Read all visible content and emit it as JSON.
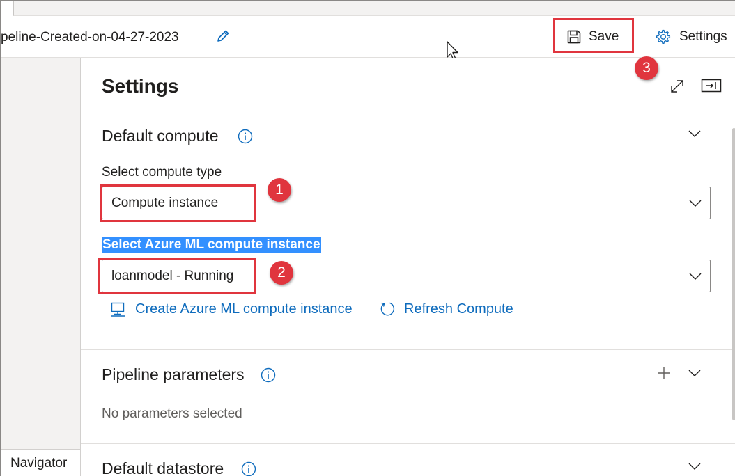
{
  "header": {
    "pipeline_name": "peline-Created-on-04-27-2023",
    "save_label": "Save",
    "settings_label": "Settings"
  },
  "callouts": {
    "badge_1": "1",
    "badge_2": "2",
    "badge_3": "3"
  },
  "left": {
    "navigator_label": "Navigator"
  },
  "panel": {
    "title": "Settings",
    "default_compute": {
      "title": "Default compute",
      "compute_type_label": "Select compute type",
      "compute_type_value": "Compute instance",
      "instance_label": "Select Azure ML compute instance",
      "instance_value": "loanmodel - Running",
      "create_link": "Create Azure ML compute instance",
      "refresh_link": "Refresh Compute"
    },
    "pipeline_parameters": {
      "title": "Pipeline parameters",
      "empty_text": "No parameters selected"
    },
    "default_datastore": {
      "title": "Default datastore"
    }
  },
  "colors": {
    "accent_link": "#0f6cbd",
    "callout_red": "#e0353e",
    "selection_blue": "#3390ff"
  },
  "icons": [
    "pencil-icon",
    "save-icon",
    "gear-icon",
    "expand-icon",
    "dock-panel-icon",
    "info-icon",
    "chevron-down-icon",
    "compute-instance-icon",
    "refresh-icon",
    "plus-icon",
    "mouse-cursor-icon"
  ]
}
